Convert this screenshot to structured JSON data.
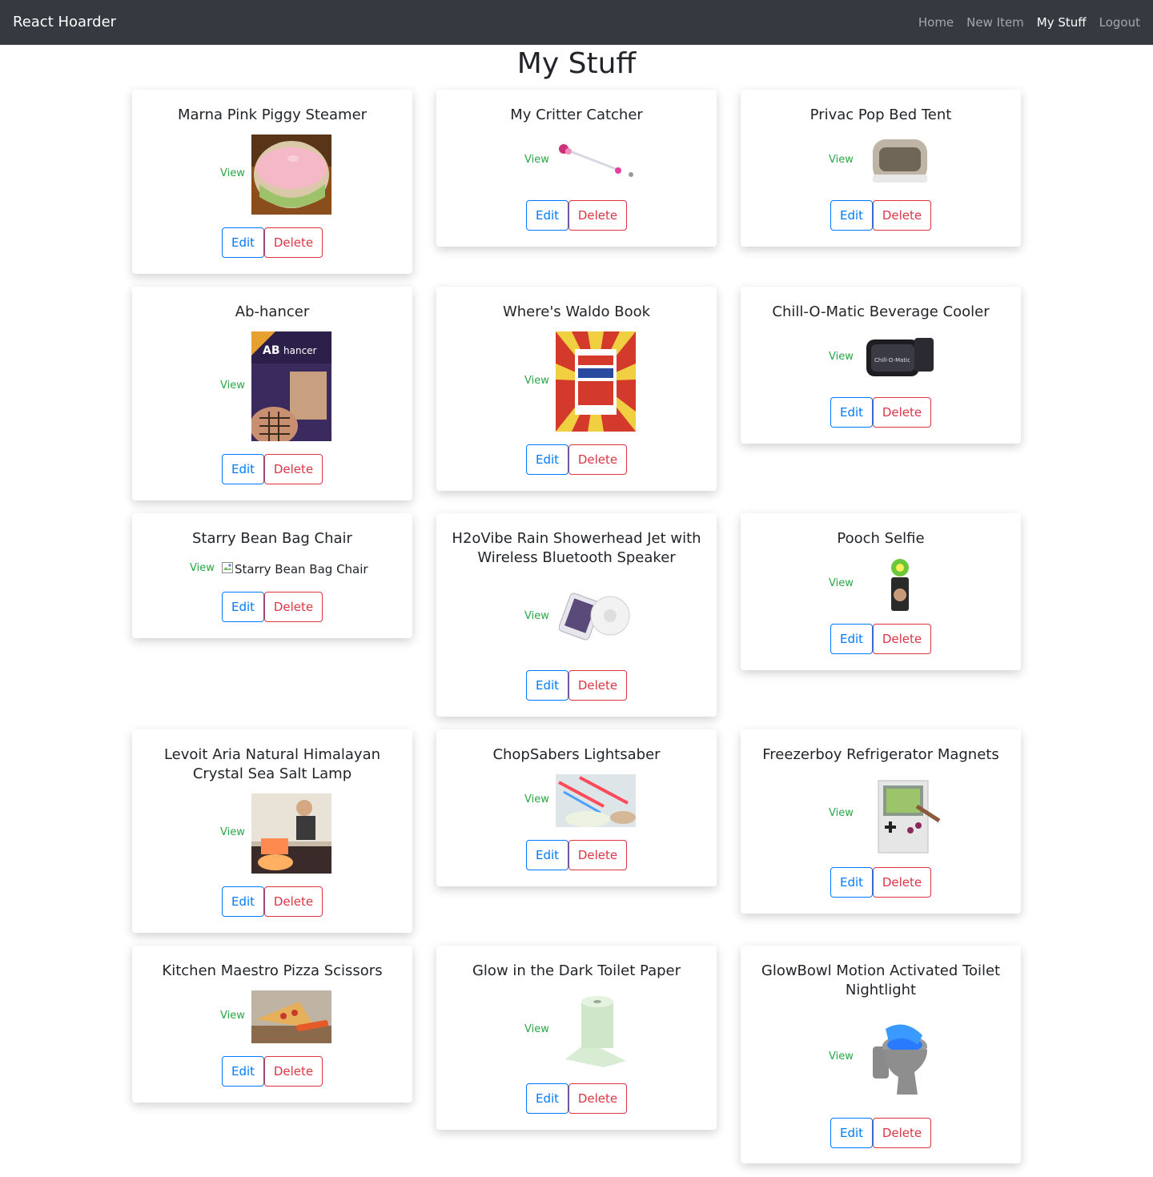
{
  "navbar": {
    "brand": "React Hoarder",
    "links": [
      {
        "label": "Home",
        "active": false
      },
      {
        "label": "New Item",
        "active": false
      },
      {
        "label": "My Stuff",
        "active": true
      },
      {
        "label": "Logout",
        "active": false
      }
    ]
  },
  "page": {
    "title": "My Stuff"
  },
  "colors": {
    "navbar_bg": "#343a40",
    "view_link": "#28a745",
    "edit": "#007bff",
    "delete": "#dc3545"
  },
  "common": {
    "view": "View",
    "edit": "Edit",
    "delete": "Delete"
  },
  "items": [
    {
      "name": "Marna Pink Piggy Steamer"
    },
    {
      "name": "My Critter Catcher"
    },
    {
      "name": "Privac Pop Bed Tent"
    },
    {
      "name": "Ab-hancer"
    },
    {
      "name": "Where's Waldo Book"
    },
    {
      "name": "Chill-O-Matic Beverage Cooler"
    },
    {
      "name": "Starry Bean Bag Chair",
      "image_alt": "Starry Bean Bag Chair"
    },
    {
      "name": "H2oVibe Rain Showerhead Jet with Wireless Bluetooth Speaker"
    },
    {
      "name": "Pooch Selfie"
    },
    {
      "name": "Levoit Aria Natural Himalayan Crystal Sea Salt Lamp"
    },
    {
      "name": "ChopSabers Lightsaber"
    },
    {
      "name": "Freezerboy Refrigerator Magnets"
    },
    {
      "name": "Kitchen Maestro Pizza Scissors"
    },
    {
      "name": "Glow in the Dark Toilet Paper"
    },
    {
      "name": "GlowBowl Motion Activated Toilet Nightlight"
    }
  ]
}
